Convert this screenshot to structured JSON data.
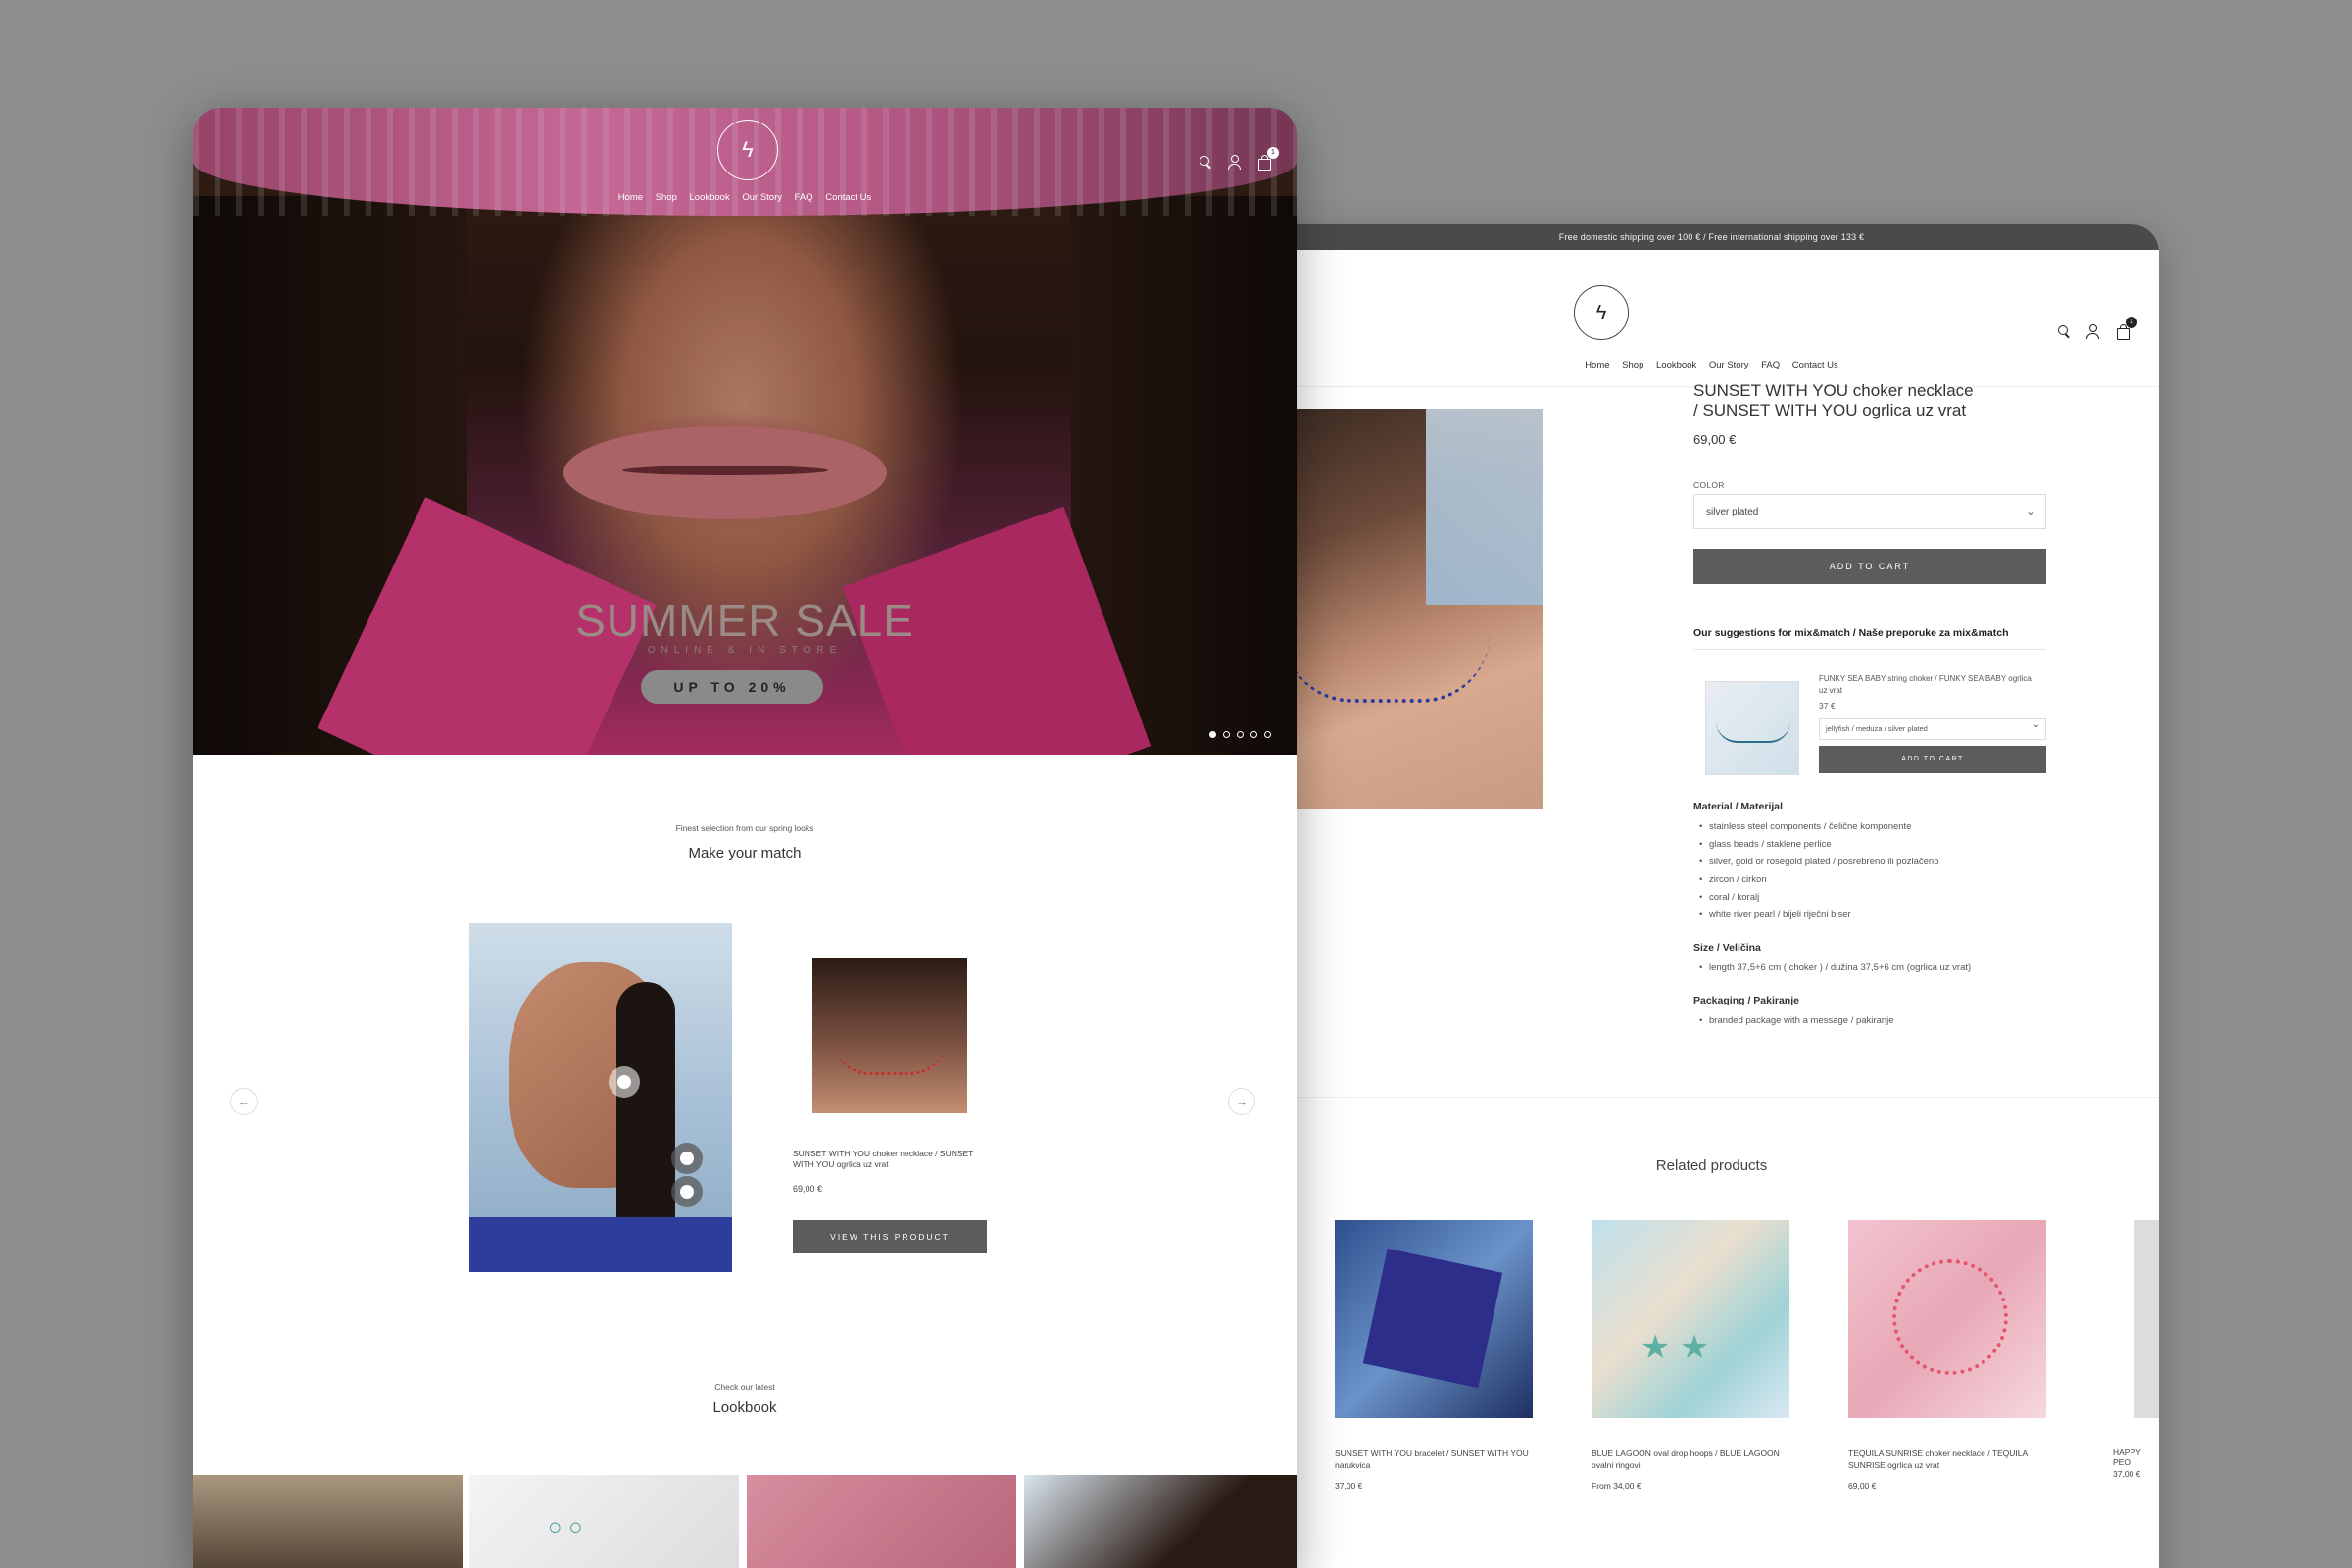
{
  "product_page": {
    "announcement": "Free domestic shipping over 100 € / Free international shipping over 133 €",
    "logo_icon": "lightning-logo",
    "nav": [
      "Home",
      "Shop",
      "Lookbook",
      "Our Story",
      "FAQ",
      "Contact Us"
    ],
    "cart_count": "1",
    "product": {
      "title_line1": "SUNSET WITH YOU choker necklace",
      "title_line2": "/ SUNSET WITH YOU ogrlica uz vrat",
      "price": "69,00 €",
      "color_label": "COLOR",
      "color_value": "silver plated",
      "add_to_cart": "ADD TO CART"
    },
    "suggestions": {
      "title": "Our suggestions for mix&match / Naše preporuke za mix&match",
      "item": {
        "name": "FUNKY SEA BABY string choker / FUNKY SEA BABY ogrlica uz vrat",
        "price": "37 €",
        "variant": "jellyfish / meduza / silver plated",
        "button": "ADD TO CART"
      }
    },
    "specs": [
      {
        "heading": "Material / Materijal",
        "items": [
          "stainless steel components / čelične komponente",
          "glass beads / staklene perlice",
          "silver, gold or rosegold plated / posrebreno ili pozlačeno",
          "zircon / cirkon",
          "coral / koralj",
          "white river pearl / bijeli riječni biser"
        ]
      },
      {
        "heading": "Size / Veličina",
        "items": [
          "length 37,5+6 cm ( choker ) / dužina 37,5+6 cm (ogrlica uz vrat)"
        ]
      },
      {
        "heading": "Packaging / Pakiranje",
        "items": [
          "branded package with a message / pakiranje"
        ]
      }
    ],
    "related": {
      "title": "Related products",
      "items": [
        {
          "name": "SUNSET WITH YOU bracelet / SUNSET WITH YOU narukvica",
          "price": "37,00 €"
        },
        {
          "name": "BLUE LAGOON oval drop hoops / BLUE LAGOON ovalni ringovi",
          "price": "From 34,00 €"
        },
        {
          "name": "TEQUILA SUNRISE choker necklace / TEQUILA SUNRISE ogrlica uz vrat",
          "price": "69,00 €"
        },
        {
          "name": "HAPPY PEO",
          "price": "37,00 €"
        }
      ]
    }
  },
  "home_page": {
    "nav": [
      "Home",
      "Shop",
      "Lookbook",
      "Our Story",
      "FAQ",
      "Contact Us"
    ],
    "cart_count": "1",
    "hero": {
      "title": "SUMMER SALE",
      "subtitle": "ONLINE & IN STORE",
      "button": "UP TO 20%",
      "slides_total": 5,
      "active_slide": 1
    },
    "match_section": {
      "eyebrow": "Finest selection from our spring looks",
      "title": "Make your match",
      "product_name": "SUNSET WITH YOU choker necklace / SUNSET WITH YOU ogrlica uz vrat",
      "product_price": "69,00 €",
      "button": "VIEW THIS PRODUCT"
    },
    "lookbook_section": {
      "eyebrow": "Check our latest",
      "title": "Lookbook"
    }
  }
}
